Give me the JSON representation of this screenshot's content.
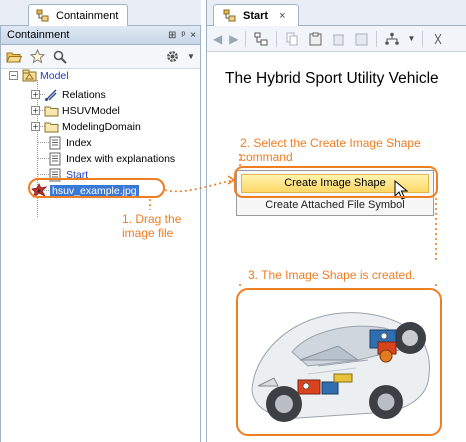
{
  "left_pane": {
    "tab_label": "Containment",
    "header_label": "Containment",
    "header_controls": [
      "⊞",
      "ᵖ",
      "×"
    ],
    "toolbar_icons": [
      "open-folder-icon",
      "star-icon",
      "search-icon",
      "gear-icon"
    ],
    "tree": {
      "root_label": "Model",
      "items": [
        {
          "label": "Relations",
          "icon": "relations-icon"
        },
        {
          "label": "HSUVModel",
          "icon": "folder-icon"
        },
        {
          "label": "ModelingDomain",
          "icon": "folder-icon"
        },
        {
          "label": "Index",
          "icon": "document-icon"
        },
        {
          "label": "Index with explanations",
          "icon": "document-icon"
        },
        {
          "label": "Start",
          "icon": "document-icon"
        },
        {
          "label": "hsuv_example.jpg",
          "icon": "image-file-icon"
        }
      ]
    }
  },
  "right_pane": {
    "tab_label": "Start",
    "tab_close": "×",
    "diagram_title": "The Hybrid Sport Utility Vehicle",
    "context_menu": {
      "items": [
        "Create Image Shape",
        "Create Attached File Symbol"
      ]
    }
  },
  "annotations": {
    "step1": "1. Drag the image file",
    "step2": "2. Select the Create Image Shape command",
    "step3": "3. The Image Shape is created."
  },
  "colors": {
    "annotation": "#ef7d22",
    "selection": "#3a78d8",
    "menu_highlight": "#ffd766",
    "tree_blue": "#1f3fbf"
  }
}
